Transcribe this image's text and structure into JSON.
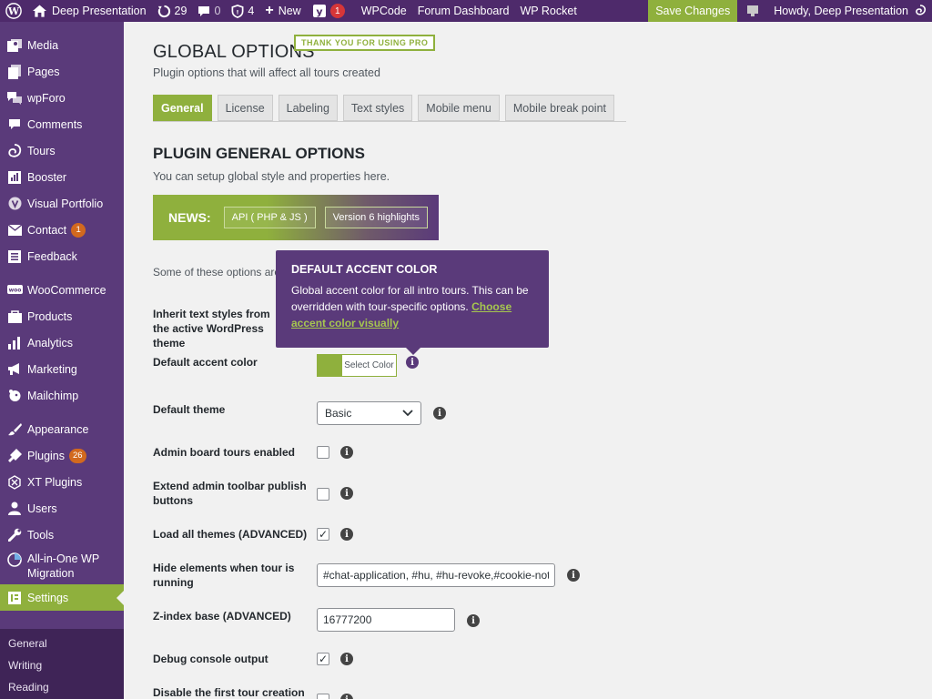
{
  "adminbar": {
    "site_name": "Deep Presentation",
    "updates_count": "29",
    "comments_count": "0",
    "shield_count": "4",
    "new_label": "New",
    "yoast_badge": "1",
    "links": [
      "WPCode",
      "Forum Dashboard",
      "WP Rocket"
    ],
    "save_label": "Save Changes",
    "howdy": "Howdy, Deep Presentation"
  },
  "sidebar": {
    "items": [
      {
        "label": "Media",
        "icon": "media-icon"
      },
      {
        "label": "Pages",
        "icon": "pages-icon"
      },
      {
        "label": "wpForo",
        "icon": "forum-icon"
      },
      {
        "label": "Comments",
        "icon": "comments-icon"
      },
      {
        "label": "Tours",
        "icon": "tours-icon"
      },
      {
        "label": "Booster",
        "icon": "booster-icon"
      },
      {
        "label": "Visual Portfolio",
        "icon": "portfolio-icon"
      },
      {
        "label": "Contact",
        "icon": "mail-icon",
        "badge": "1"
      },
      {
        "label": "Feedback",
        "icon": "feedback-icon"
      },
      {
        "label": "WooCommerce",
        "icon": "woo-icon"
      },
      {
        "label": "Products",
        "icon": "products-icon"
      },
      {
        "label": "Analytics",
        "icon": "analytics-icon"
      },
      {
        "label": "Marketing",
        "icon": "marketing-icon"
      },
      {
        "label": "Mailchimp",
        "icon": "mailchimp-icon"
      },
      {
        "label": "Appearance",
        "icon": "appearance-icon"
      },
      {
        "label": "Plugins",
        "icon": "plugins-icon",
        "badge": "26"
      },
      {
        "label": "XT Plugins",
        "icon": "xt-icon"
      },
      {
        "label": "Users",
        "icon": "users-icon"
      },
      {
        "label": "Tools",
        "icon": "tools-icon"
      },
      {
        "label": "All-in-One WP Migration",
        "icon": "migration-icon"
      },
      {
        "label": "Settings",
        "icon": "settings-icon"
      }
    ],
    "submenu": [
      "General",
      "Writing",
      "Reading"
    ]
  },
  "page": {
    "title": "GLOBAL OPTIONS",
    "pro_badge": "THANK YOU FOR USING PRO",
    "subtitle": "Plugin options that will affect all tours created",
    "tabs": [
      "General",
      "License",
      "Labeling",
      "Text styles",
      "Mobile menu",
      "Mobile break point"
    ],
    "section_title": "PLUGIN GENERAL OPTIONS",
    "section_subtitle": "You can setup global style and properties here.",
    "news": {
      "label": "NEWS:",
      "buttons": [
        "API ( PHP & JS )",
        "Version 6 highlights"
      ]
    },
    "note": "Some of these options are"
  },
  "options": {
    "inherit_label": "Inherit text styles from the active WordPress theme",
    "accent_label": "Default accent color",
    "accent_button": "Select Color",
    "accent_color": "#8fb03d",
    "theme_label": "Default theme",
    "theme_value": "Basic",
    "admin_board_label": "Admin board tours enabled",
    "extend_toolbar_label": "Extend admin toolbar publish buttons",
    "load_themes_label": "Load all themes (ADVANCED)",
    "hide_elements_label": "Hide elements when tour is running",
    "hide_elements_value": "#chat-application, #hu, #hu-revoke,#cookie-notice",
    "zindex_label": "Z-index base (ADVANCED)",
    "zindex_value": "16777200",
    "debug_label": "Debug console output",
    "disable_first_label": "Disable the first tour creation"
  },
  "tooltip": {
    "title": "DEFAULT ACCENT COLOR",
    "body": "Global accent color for all intro tours. This can be overridden with tour-specific options.",
    "link": "Choose accent color visually"
  }
}
